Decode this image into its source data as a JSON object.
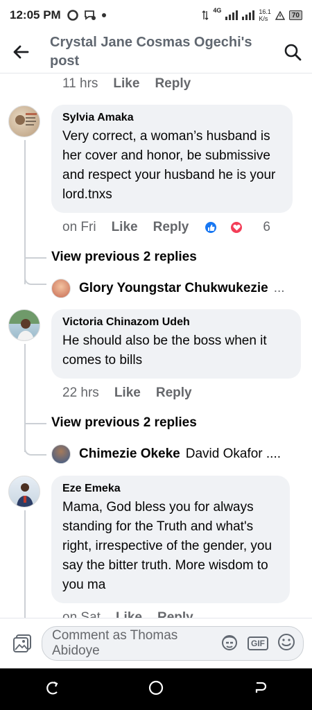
{
  "status_bar": {
    "time": "12:05 PM",
    "network": "4G",
    "speed_value": "16.1",
    "speed_unit": "K/s",
    "battery": "70"
  },
  "header": {
    "title": "Crystal Jane Cosmas Ogechi's post"
  },
  "top_meta": {
    "time": "11 hrs",
    "like": "Like",
    "reply": "Reply"
  },
  "comments": [
    {
      "name": "Sylvia Amaka",
      "text": "Very correct, a woman’s husband is her cover and honor, be submissive and respect your husband he is your lord.tnxs",
      "time": "on Fri",
      "like": "Like",
      "reply": "Reply",
      "reaction_count": "6",
      "view_previous": "View previous 2 replies",
      "last_reply_name": "Glory Youngstar Chukwukezie",
      "last_reply_text": "..."
    },
    {
      "name": "Victoria Chinazom Udeh",
      "text": "He should also be the boss when it comes to bills",
      "time": "22 hrs",
      "like": "Like",
      "reply": "Reply",
      "view_previous": "View previous 2 replies",
      "last_reply_name": "Chimezie Okeke",
      "last_reply_text": "David Okafor ...."
    },
    {
      "name": "Eze Emeka",
      "text": "Mama, God bless you for always standing for the Truth and what's right, irrespective of the gender, you say the bitter truth. More wisdom to you ma",
      "time": "on Sat",
      "like": "Like",
      "reply": "Reply"
    }
  ],
  "composer": {
    "placeholder": "Comment as Thomas Abidoye",
    "gif_label": "GIF"
  },
  "colors": {
    "bubble": "#f0f2f5",
    "like_blue": "#1877f2",
    "love_red": "#f33e58",
    "meta_gray": "#65676b"
  }
}
